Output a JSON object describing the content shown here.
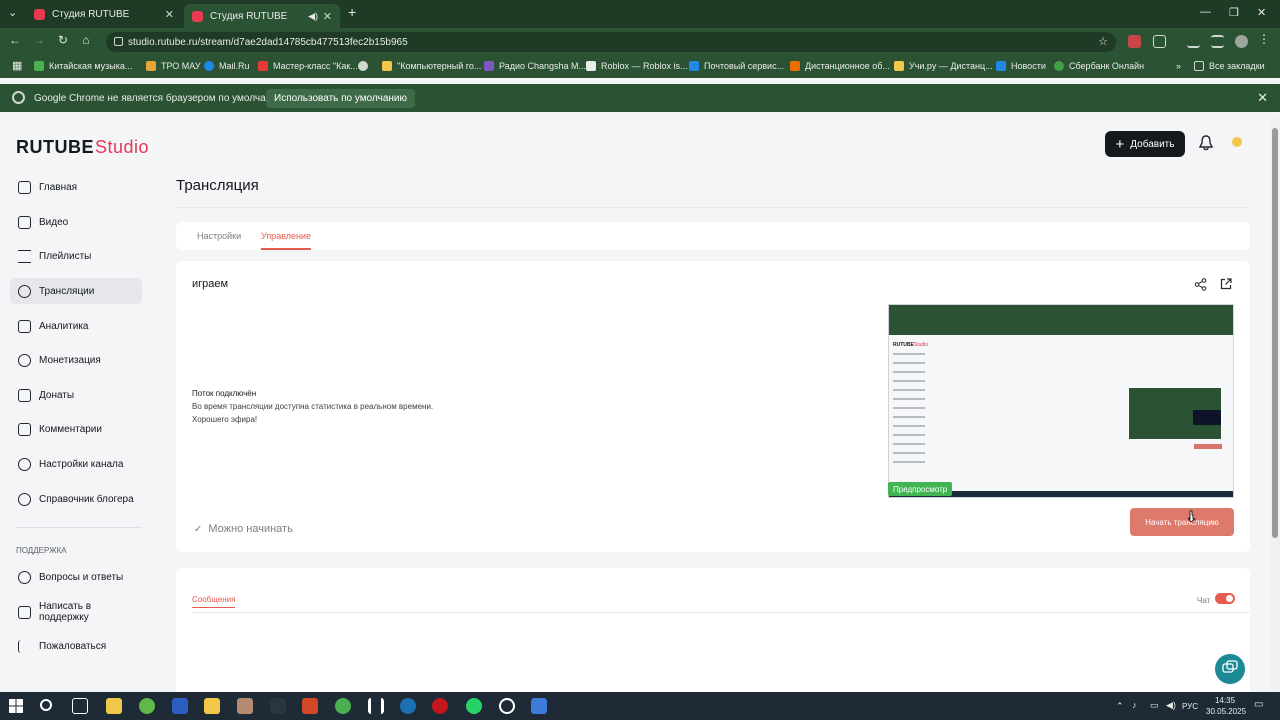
{
  "browser": {
    "tabs": [
      {
        "title": "Студия RUTUBE",
        "active": false
      },
      {
        "title": "Студия RUTUBE",
        "active": true
      }
    ],
    "url": "studio.rutube.ru/stream/d7ae2dad14785cb477513fec2b15b965",
    "bookmarks": [
      "Китайская музыка...",
      "ТРО МАУ",
      "Mail.Ru",
      "Мастер-класс \"Как...",
      "\"Компьютерный го...",
      "Радио Changsha M...",
      "Roblox — Roblox is...",
      "Почтовый сервис...",
      "Дистанционное об...",
      "Учи.ру — Дистанц...",
      "Новости",
      "Сбербанк Онлайн",
      "Все закладки"
    ],
    "infobar": {
      "message": "Google Chrome не является браузером по умолчанию.",
      "button": "Использовать по умолчанию"
    }
  },
  "header": {
    "logo_main": "RUTUBE",
    "logo_accent": "Studio",
    "add_button": "Добавить"
  },
  "sidebar": {
    "items": [
      {
        "label": "Главная",
        "icon": "home-icon"
      },
      {
        "label": "Видео",
        "icon": "video-icon"
      },
      {
        "label": "Плейлисты",
        "icon": "playlist-icon"
      },
      {
        "label": "Трансляции",
        "icon": "broadcast-icon",
        "active": true
      },
      {
        "label": "Аналитика",
        "icon": "analytics-icon"
      },
      {
        "label": "Монетизация",
        "icon": "ruble-icon"
      },
      {
        "label": "Донаты",
        "icon": "donate-icon"
      },
      {
        "label": "Комментарии",
        "icon": "comment-icon"
      },
      {
        "label": "Настройки канала",
        "icon": "gear-icon"
      },
      {
        "label": "Справочник блогера",
        "icon": "book-icon"
      }
    ],
    "support_heading": "Поддержка",
    "support_items": [
      {
        "label": "Вопросы и ответы",
        "icon": "help-icon"
      },
      {
        "label": "Написать в поддержку",
        "icon": "mail-icon"
      },
      {
        "label": "Пожаловаться",
        "icon": "flag-icon"
      }
    ]
  },
  "main": {
    "title": "Трансляция",
    "tabs": [
      {
        "label": "Настройки"
      },
      {
        "label": "Управление",
        "active": true
      }
    ],
    "stream": {
      "name": "играем",
      "status_title": "Поток подключён",
      "status_text": "Во время трансляции доступна статистика в реальном времени.",
      "status_bye": "Хорошего эфира!",
      "ready": "Можно начинать",
      "preview_badge": "Предпросмотр",
      "start_button": "Начать трансляцию"
    },
    "chat": {
      "tab": "Сообщения",
      "toggle_label": "Чат",
      "enabled": true
    }
  },
  "taskbar": {
    "lang": "РУС",
    "time": "14:35",
    "date": "30.05.2025"
  },
  "colors": {
    "accent": "#e35d4f",
    "brand": "#e8375a",
    "browser": "#2c5234"
  }
}
